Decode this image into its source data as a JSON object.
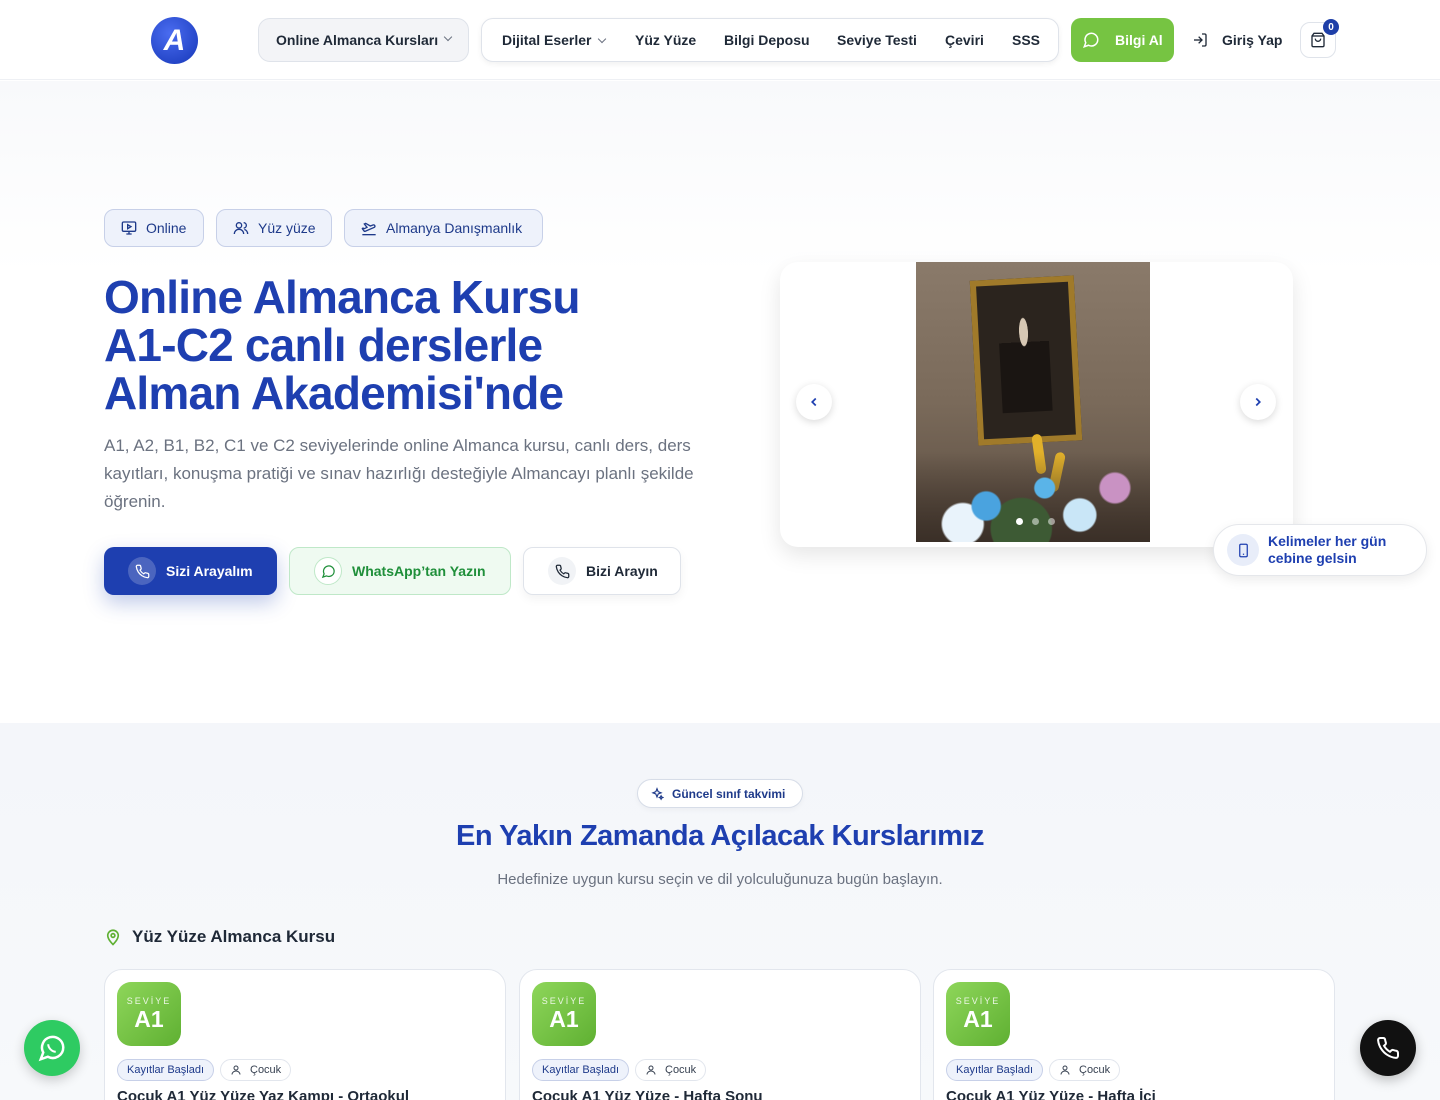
{
  "brand": {
    "logo_letter": "A"
  },
  "nav": {
    "courses_menu": "Online Almanca Kursları",
    "items": [
      "Dijital Eserler",
      "Yüz Yüze",
      "Bilgi Deposu",
      "Seviye Testi",
      "Çeviri",
      "SSS"
    ],
    "info_button": "Bilgi Al",
    "login": "Giriş Yap",
    "cart_count": "0"
  },
  "hero": {
    "tags": [
      "Online",
      "Yüz yüze",
      "Almanya Danışmanlık"
    ],
    "title_line1": "Online Almanca Kursu",
    "title_line2": "A1-C2 canlı derslerle",
    "title_line3": "Alman Akademisi'nde",
    "description": "A1, A2, B1, B2, C1 ve C2 seviyelerinde online Almanca kursu, canlı ders, ders kayıtları, konuşma pratiği ve sınav hazırlığı desteğiyle Almancayı planlı şekilde öğrenin.",
    "cta_call_me": "Sizi Arayalım",
    "cta_whatsapp": "WhatsApp’tan Yazın",
    "cta_call_us": "Bizi Arayın",
    "slider_active": 1,
    "slider_count": 3,
    "word_card": "Kelimeler her gün cebine gelsin"
  },
  "courses": {
    "tag": "Güncel sınıf takvimi",
    "title": "En Yakın Zamanda Açılacak Kurslarımız",
    "subtitle": "Hedefinize uygun kursu seçin ve dil yolculuğunuza bugün başlayın.",
    "location_heading": "Yüz Yüze Almanca Kursu",
    "cards": [
      {
        "level_label": "SEVİYE",
        "level": "A1",
        "status": "Kayıtlar Başladı",
        "audience": "Çocuk",
        "title": "Çocuk A1 Yüz Yüze Yaz Kampı - Ortaokul"
      },
      {
        "level_label": "SEVİYE",
        "level": "A1",
        "status": "Kayıtlar Başladı",
        "audience": "Çocuk",
        "title": "Çocuk A1 Yüz Yüze - Hafta Sonu"
      },
      {
        "level_label": "SEVİYE",
        "level": "A1",
        "status": "Kayıtlar Başladı",
        "audience": "Çocuk",
        "title": "Çocuk A1 Yüz Yüze - Hafta İçi"
      }
    ]
  },
  "colors": {
    "brand_blue": "#1e3fb0",
    "accent_green": "#76c442",
    "whatsapp": "#2ecb62"
  }
}
